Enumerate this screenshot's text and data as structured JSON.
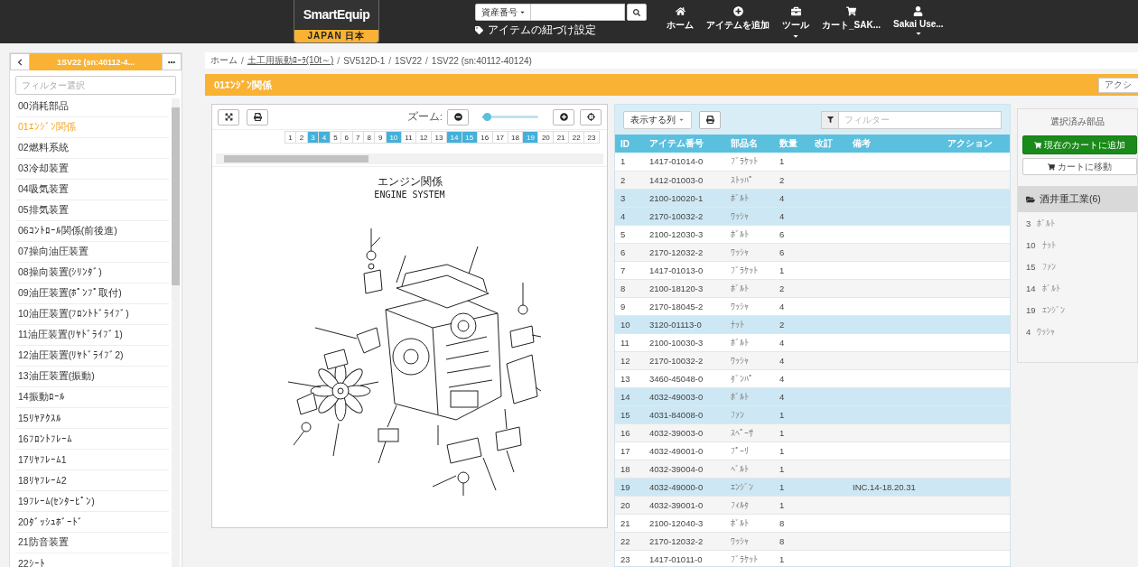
{
  "top_bar": {
    "logo": {
      "wordmark": "SmartEquip",
      "region": "JAPAN 日本"
    },
    "search": {
      "scope": "資産番号"
    },
    "link": "アイテムの紐づけ設定",
    "nav": [
      {
        "label": "ホーム",
        "has_menu": false
      },
      {
        "label": "アイテムを追加",
        "has_menu": false
      },
      {
        "label": "ツール",
        "has_menu": true
      },
      {
        "label": "カート_SAK...",
        "has_menu": false
      },
      {
        "label": "Sakai Use...",
        "has_menu": true
      }
    ]
  },
  "sidebar": {
    "title": "1SV22 (sn:40112-4...",
    "filter_placeholder": "フィルター選択",
    "items": [
      {
        "label": "00消耗部品",
        "selected": false
      },
      {
        "label": "01ｴﾝｼﾞﾝ関係",
        "selected": true
      },
      {
        "label": "02燃料系統",
        "selected": false
      },
      {
        "label": "03冷却装置",
        "selected": false
      },
      {
        "label": "04吸気装置",
        "selected": false
      },
      {
        "label": "05排気装置",
        "selected": false
      },
      {
        "label": "06ｺﾝﾄﾛｰﾙ関係(前後進)",
        "selected": false
      },
      {
        "label": "07操向油圧装置",
        "selected": false
      },
      {
        "label": "08操向装置(ｼﾘﾝﾀﾞ)",
        "selected": false
      },
      {
        "label": "09油圧装置(ﾎﾟﾝﾌﾟ取付)",
        "selected": false
      },
      {
        "label": "10油圧装置(ﾌﾛﾝﾄﾄﾞﾗｲﾌﾞ)",
        "selected": false
      },
      {
        "label": "11油圧装置(ﾘﾔﾄﾞﾗｲﾌﾞ1)",
        "selected": false
      },
      {
        "label": "12油圧装置(ﾘﾔﾄﾞﾗｲﾌﾞ2)",
        "selected": false
      },
      {
        "label": "13油圧装置(振動)",
        "selected": false
      },
      {
        "label": "14振動ﾛｰﾙ",
        "selected": false
      },
      {
        "label": "15ﾘﾔｱｸｽﾙ",
        "selected": false
      },
      {
        "label": "16ﾌﾛﾝﾄﾌﾚｰﾑ",
        "selected": false
      },
      {
        "label": "17ﾘﾔﾌﾚｰﾑ1",
        "selected": false
      },
      {
        "label": "18ﾘﾔﾌﾚｰﾑ2",
        "selected": false
      },
      {
        "label": "19ﾌﾚｰﾑ(ｾﾝﾀｰﾋﾟﾝ)",
        "selected": false
      },
      {
        "label": "20ﾀﾞｯｼｭﾎﾞｰﾄﾞ",
        "selected": false
      },
      {
        "label": "21防音装置",
        "selected": false
      },
      {
        "label": "22ｼｰﾄ",
        "selected": false
      }
    ]
  },
  "breadcrumb": {
    "separator": "/",
    "items": [
      {
        "label": "ホーム",
        "underlined": false
      },
      {
        "label": "土工用振動ﾛｰﾗ(10t～)",
        "underlined": true
      },
      {
        "label": "SV512D-1",
        "underlined": false
      },
      {
        "label": "1SV22",
        "underlined": false
      },
      {
        "label": "1SV22 (sn:40112-40124)",
        "underlined": false
      }
    ]
  },
  "section": {
    "title": "01ｴﾝｼﾞﾝ関係",
    "action_button": "アクシ"
  },
  "diagram": {
    "zoom_label": "ズーム:",
    "zoom": {
      "level": 0.08
    },
    "pages": [
      {
        "label": "1",
        "selected": false
      },
      {
        "label": "2",
        "selected": false
      },
      {
        "label": "3",
        "selected": true
      },
      {
        "label": "4",
        "selected": true
      },
      {
        "label": "5",
        "selected": false
      },
      {
        "label": "6",
        "selected": false
      },
      {
        "label": "7",
        "selected": false
      },
      {
        "label": "8",
        "selected": false
      },
      {
        "label": "9",
        "selected": false
      },
      {
        "label": "10",
        "selected": true
      },
      {
        "label": "11",
        "selected": false
      },
      {
        "label": "12",
        "selected": false
      },
      {
        "label": "13",
        "selected": false
      },
      {
        "label": "14",
        "selected": true
      },
      {
        "label": "15",
        "selected": true
      },
      {
        "label": "16",
        "selected": false
      },
      {
        "label": "17",
        "selected": false
      },
      {
        "label": "18",
        "selected": false
      },
      {
        "label": "19",
        "selected": true
      },
      {
        "label": "20",
        "selected": false
      },
      {
        "label": "21",
        "selected": false
      },
      {
        "label": "22",
        "selected": false
      },
      {
        "label": "23",
        "selected": false
      }
    ],
    "title": "エンジン関係",
    "subtitle": "ENGINE SYSTEM"
  },
  "parts_table": {
    "columns_button": "表示する列",
    "filter_placeholder": "フィルター",
    "columns": [
      "ID",
      "アイテム番号",
      "部品名",
      "数量",
      "改訂",
      "備考",
      "アクション"
    ],
    "rows": [
      {
        "id": "1",
        "item_number": "1417-01014-0",
        "part_name": "ﾌﾞﾗｹｯﾄ",
        "quantity": "1",
        "selected": false
      },
      {
        "id": "2",
        "item_number": "1412-01003-0",
        "part_name": "ｽﾄｯﾊﾟ",
        "quantity": "2",
        "selected": false
      },
      {
        "id": "3",
        "item_number": "2100-10020-1",
        "part_name": "ﾎﾞﾙﾄ",
        "quantity": "4",
        "selected": true
      },
      {
        "id": "4",
        "item_number": "2170-10032-2",
        "part_name": "ﾜｯｼｬ",
        "quantity": "4",
        "selected": true
      },
      {
        "id": "5",
        "item_number": "2100-12030-3",
        "part_name": "ﾎﾞﾙﾄ",
        "quantity": "6",
        "selected": false
      },
      {
        "id": "6",
        "item_number": "2170-12032-2",
        "part_name": "ﾜｯｼｬ",
        "quantity": "6",
        "selected": false
      },
      {
        "id": "7",
        "item_number": "1417-01013-0",
        "part_name": "ﾌﾞﾗｹｯﾄ",
        "quantity": "1",
        "selected": false
      },
      {
        "id": "8",
        "item_number": "2100-18120-3",
        "part_name": "ﾎﾞﾙﾄ",
        "quantity": "2",
        "selected": false
      },
      {
        "id": "9",
        "item_number": "2170-18045-2",
        "part_name": "ﾜｯｼｬ",
        "quantity": "4",
        "selected": false
      },
      {
        "id": "10",
        "item_number": "3120-01113-0",
        "part_name": "ﾅｯﾄ",
        "quantity": "2",
        "selected": true
      },
      {
        "id": "11",
        "item_number": "2100-10030-3",
        "part_name": "ﾎﾞﾙﾄ",
        "quantity": "4",
        "selected": false
      },
      {
        "id": "12",
        "item_number": "2170-10032-2",
        "part_name": "ﾜｯｼｬ",
        "quantity": "4",
        "selected": false
      },
      {
        "id": "13",
        "item_number": "3460-45048-0",
        "part_name": "ﾀﾞﾝﾊﾟ",
        "quantity": "4",
        "selected": false
      },
      {
        "id": "14",
        "item_number": "4032-49003-0",
        "part_name": "ﾎﾞﾙﾄ",
        "quantity": "4",
        "selected": true
      },
      {
        "id": "15",
        "item_number": "4031-84008-0",
        "part_name": "ﾌｧﾝ",
        "quantity": "1",
        "selected": true
      },
      {
        "id": "16",
        "item_number": "4032-39003-0",
        "part_name": "ｽﾍﾟｰｻ",
        "quantity": "1",
        "selected": false
      },
      {
        "id": "17",
        "item_number": "4032-49001-0",
        "part_name": "ﾌﾟｰﾘ",
        "quantity": "1",
        "selected": false
      },
      {
        "id": "18",
        "item_number": "4032-39004-0",
        "part_name": "ﾍﾞﾙﾄ",
        "quantity": "1",
        "selected": false
      },
      {
        "id": "19",
        "item_number": "4032-49000-0",
        "part_name": "ｴﾝｼﾞﾝ",
        "quantity": "1",
        "note": "INC.14-18.20.31",
        "selected": true
      },
      {
        "id": "20",
        "item_number": "4032-39001-0",
        "part_name": "ﾌｨﾙﾀ",
        "quantity": "1",
        "selected": false
      },
      {
        "id": "21",
        "item_number": "2100-12040-3",
        "part_name": "ﾎﾞﾙﾄ",
        "quantity": "8",
        "selected": false
      },
      {
        "id": "22",
        "item_number": "2170-12032-2",
        "part_name": "ﾜｯｼｬ",
        "quantity": "8",
        "selected": false
      },
      {
        "id": "23",
        "item_number": "1417-01011-0",
        "part_name": "ﾌﾞﾗｹｯﾄ",
        "quantity": "1",
        "selected": false
      }
    ]
  },
  "selected_parts": {
    "title": "選択済み部品",
    "add_to_cart_button": "現在のカートに追加",
    "go_to_cart_button": "カートに移動",
    "group": {
      "label": "酒井重工業(6)",
      "items": [
        {
          "id": "3",
          "name": "ﾎﾞﾙﾄ"
        },
        {
          "id": "10",
          "name": "ﾅｯﾄ"
        },
        {
          "id": "15",
          "name": "ﾌｧﾝ"
        },
        {
          "id": "14",
          "name": "ﾎﾞﾙﾄ"
        },
        {
          "id": "19",
          "name": "ｴﾝｼﾞﾝ"
        },
        {
          "id": "4",
          "name": "ﾜｯｼｬ"
        }
      ]
    }
  }
}
